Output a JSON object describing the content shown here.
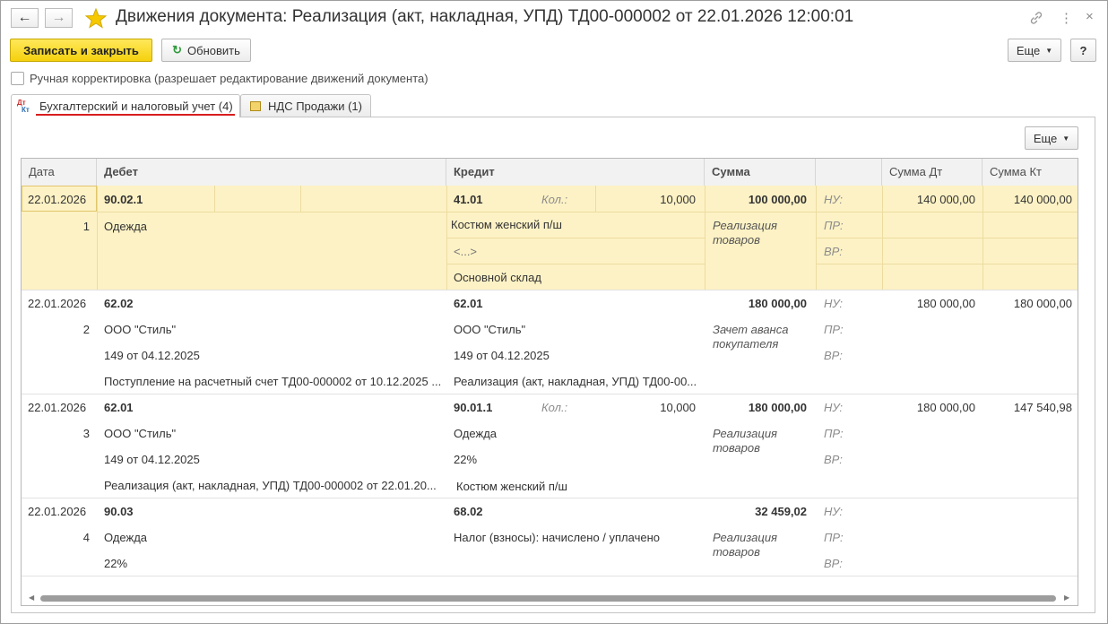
{
  "window": {
    "title": "Движения документа: Реализация (акт, накладная, УПД) ТД00-000002 от 22.01.2026 12:00:01",
    "back_icon": "arrow-left-icon",
    "forward_icon": "arrow-right-icon",
    "favorite_icon": "star-icon",
    "link_icon": "link-icon",
    "menu_icon": "more-vertical-icon",
    "close_icon": "close-icon"
  },
  "toolbar": {
    "save_close": "Записать и закрыть",
    "refresh": "Обновить",
    "more": "Еще",
    "help": "?"
  },
  "manual_edit": {
    "label": "Ручная корректировка (разрешает редактирование движений документа)",
    "checked": false
  },
  "tabs": [
    {
      "label": "Бухгалтерский и налоговый учет (4)",
      "icon": "dt-kt-icon",
      "active": true
    },
    {
      "label": "НДС Продажи (1)",
      "icon": "register-icon",
      "active": false
    }
  ],
  "table_toolbar": {
    "more": "Еще"
  },
  "columns": [
    "Дата",
    "Дебет",
    "Кредит",
    "Сумма",
    "",
    "Сумма Дт",
    "Сумма Кт"
  ],
  "colors": {
    "selected_row": "#fdf2c5",
    "primary_button": "#f5d10e",
    "underline": "#d81e1e"
  },
  "rows": [
    {
      "date": "22.01.2026",
      "num": "1",
      "debit_account": "90.02.1",
      "debit_sub": [
        "Одежда"
      ],
      "credit_account": "41.01",
      "credit_qty_label": "Кол.:",
      "credit_qty": "10,000",
      "credit_sub": [
        "Костюм женский п/ш",
        "<...>",
        "Основной склад"
      ],
      "amount": "100 000,00",
      "content": "Реализация товаров",
      "nu": "НУ:",
      "pr": "ПР:",
      "vr": "ВР:",
      "sum_dt": "140 000,00",
      "sum_kt": "140 000,00"
    },
    {
      "date": "22.01.2026",
      "num": "2",
      "debit_account": "62.02",
      "debit_sub": [
        "ООО \"Стиль\"",
        "149 от 04.12.2025",
        "Поступление на расчетный счет ТД00-000002 от 10.12.2025 ..."
      ],
      "credit_account": "62.01",
      "credit_sub": [
        "ООО \"Стиль\"",
        "149 от 04.12.2025",
        "Реализация (акт, накладная, УПД) ТД00-00..."
      ],
      "amount": "180 000,00",
      "content": "Зачет аванса покупателя",
      "nu": "НУ:",
      "pr": "ПР:",
      "vr": "ВР:",
      "sum_dt": "180 000,00",
      "sum_kt": "180 000,00"
    },
    {
      "date": "22.01.2026",
      "num": "3",
      "debit_account": "62.01",
      "debit_sub": [
        "ООО \"Стиль\"",
        "149 от 04.12.2025",
        "Реализация (акт, накладная, УПД) ТД00-000002 от 22.01.20..."
      ],
      "credit_account": "90.01.1",
      "credit_qty_label": "Кол.:",
      "credit_qty": "10,000",
      "credit_sub": [
        "Одежда",
        "22%",
        "Костюм женский п/ш"
      ],
      "amount": "180 000,00",
      "content": "Реализация товаров",
      "nu": "НУ:",
      "pr": "ПР:",
      "vr": "ВР:",
      "sum_dt": "180 000,00",
      "sum_kt": "147 540,98"
    },
    {
      "date": "22.01.2026",
      "num": "4",
      "debit_account": "90.03",
      "debit_sub": [
        "Одежда",
        "22%"
      ],
      "credit_account": "68.02",
      "credit_sub": [
        "Налог (взносы): начислено / уплачено"
      ],
      "amount": "32 459,02",
      "content": "Реализация товаров",
      "nu": "НУ:",
      "pr": "ПР:",
      "vr": "ВР:",
      "sum_dt": "",
      "sum_kt": ""
    }
  ]
}
